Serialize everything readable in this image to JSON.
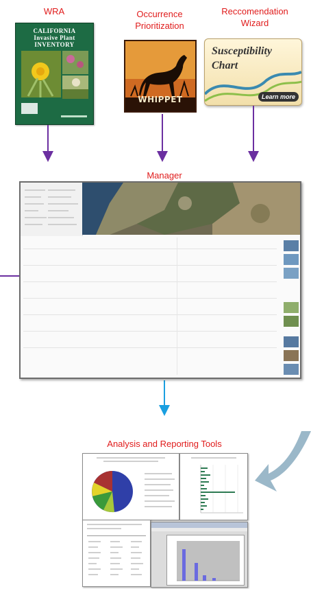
{
  "labels": {
    "wra": "WRA",
    "occurrence": "Occurrence Prioritization",
    "recommendation": "Reccomendation Wizard",
    "manager": "Manager",
    "analysis": "Analysis and Reporting Tools"
  },
  "wra_cover": {
    "title_line1": "CALIFORNIA",
    "title_line2": "Invasive Plant",
    "title_line3": "INVENTORY"
  },
  "whippet_logo": {
    "name": "WHIPPET"
  },
  "susceptibility_chart": {
    "title_line1": "Susceptibility",
    "title_line2": "Chart",
    "button": "Learn more"
  },
  "colors": {
    "label_red": "#e01b1b",
    "arrow_purple": "#6b2fa0",
    "arrow_blue": "#1a9fe0",
    "curve_blue": "#9bb8c9"
  }
}
